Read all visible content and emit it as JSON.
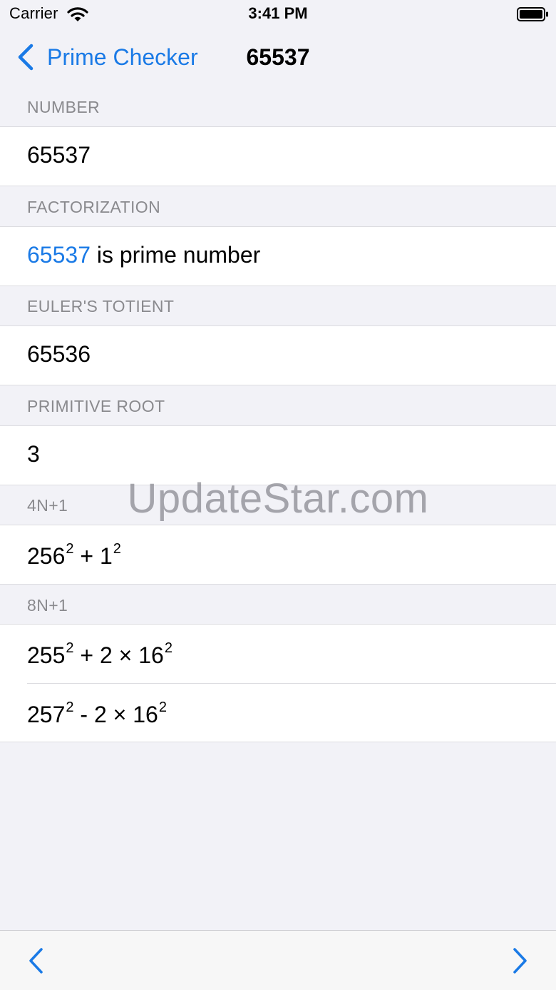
{
  "status_bar": {
    "carrier": "Carrier",
    "time": "3:41 PM"
  },
  "nav": {
    "back_label": "Prime Checker",
    "title": "65537"
  },
  "sections": {
    "number": {
      "header": "NUMBER",
      "value": "65537"
    },
    "factorization": {
      "header": "FACTORIZATION",
      "link_value": "65537",
      "text": " is prime number"
    },
    "totient": {
      "header": "EULER'S TOTIENT",
      "value": "65536"
    },
    "primitive_root": {
      "header": "PRIMITIVE ROOT",
      "value": "3"
    },
    "four_n_plus_one": {
      "header": "4N+1",
      "a": "256",
      "op": " + ",
      "b": "1",
      "exp": "2"
    },
    "eight_n_plus_one": {
      "header": "8N+1",
      "row1": {
        "a": "255",
        "op": " + 2 × ",
        "b": "16",
        "exp": "2"
      },
      "row2": {
        "a": "257",
        "op": " - 2 × ",
        "b": "16",
        "exp": "2"
      }
    }
  },
  "watermark": "UpdateStar.com",
  "colors": {
    "accent": "#1a7ae6",
    "background": "#f2f2f7",
    "header_text": "#8a8a8e"
  },
  "icons": [
    "wifi-icon",
    "battery-icon",
    "chevron-left-icon",
    "chevron-right-icon"
  ]
}
